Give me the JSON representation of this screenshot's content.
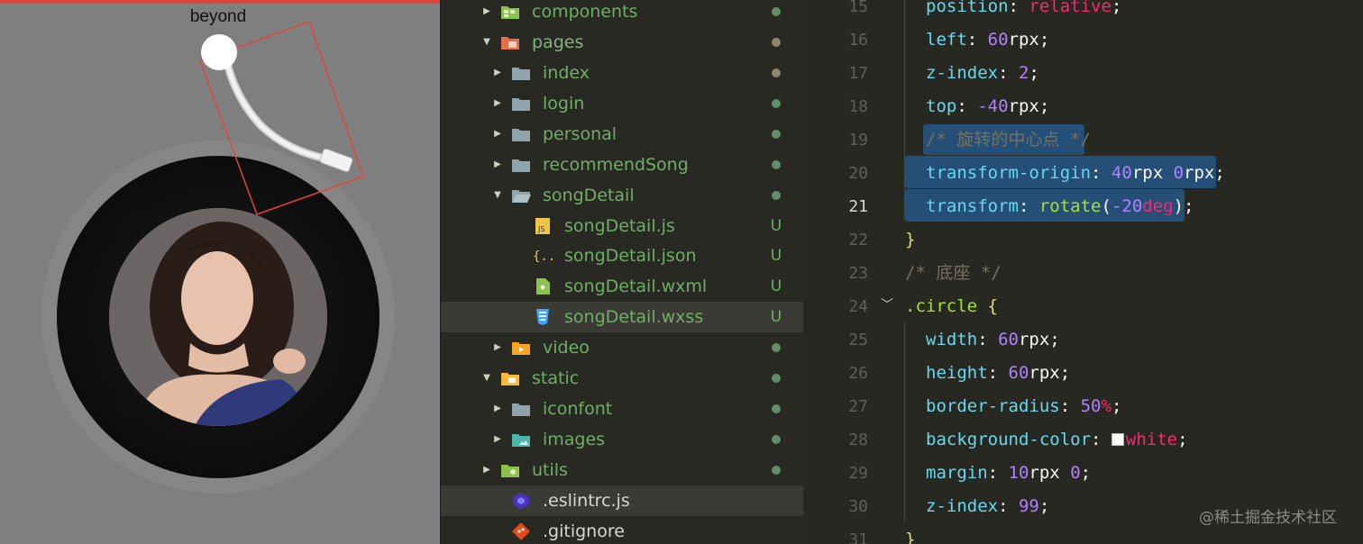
{
  "simulator": {
    "song_title": "beyond",
    "accent_color": "#d9473b"
  },
  "file_tree": {
    "items": [
      {
        "name": "components",
        "icon": "folder-components-icon",
        "status": "dot",
        "status_color": "#5f8f65",
        "expanded": false
      },
      {
        "name": "pages",
        "icon": "folder-pages-open-icon",
        "status": "dot",
        "status_color": "#8d8576",
        "expanded": true
      },
      {
        "name": "index",
        "icon": "folder-icon",
        "status": "dot",
        "status_color": "#8d8576",
        "expanded": false
      },
      {
        "name": "login",
        "icon": "folder-icon",
        "status": "dot",
        "status_color": "#5f8f65",
        "expanded": false
      },
      {
        "name": "personal",
        "icon": "folder-icon",
        "status": "dot",
        "status_color": "#5f8f65",
        "expanded": false
      },
      {
        "name": "recommendSong",
        "icon": "folder-icon",
        "status": "dot",
        "status_color": "#5f8f65",
        "expanded": false
      },
      {
        "name": "songDetail",
        "icon": "folder-open-icon",
        "status": "dot",
        "status_color": "#5f8f65",
        "expanded": true
      },
      {
        "name": "songDetail.js",
        "icon": "js-file-icon",
        "status": "U",
        "status_color": "#6fb06f"
      },
      {
        "name": "songDetail.json",
        "icon": "json-file-icon",
        "status": "U",
        "status_color": "#6fb06f"
      },
      {
        "name": "songDetail.wxml",
        "icon": "wxml-file-icon",
        "status": "U",
        "status_color": "#6fb06f"
      },
      {
        "name": "songDetail.wxss",
        "icon": "css-file-icon",
        "status": "U",
        "status_color": "#6fb06f"
      },
      {
        "name": "video",
        "icon": "folder-video-icon",
        "status": "dot",
        "status_color": "#5f8f65",
        "expanded": false
      },
      {
        "name": "static",
        "icon": "folder-static-open-icon",
        "status": "dot",
        "status_color": "#5f8f65",
        "expanded": true
      },
      {
        "name": "iconfont",
        "icon": "folder-icon",
        "status": "dot",
        "status_color": "#5f8f65",
        "expanded": false
      },
      {
        "name": "images",
        "icon": "folder-images-icon",
        "status": "dot",
        "status_color": "#5f8f65",
        "expanded": false
      },
      {
        "name": "utils",
        "icon": "folder-utils-icon",
        "status": "dot",
        "status_color": "#5f8f65",
        "expanded": false
      },
      {
        "name": ".eslintrc.js",
        "icon": "eslint-icon",
        "status": ""
      },
      {
        "name": ".gitignore",
        "icon": "git-icon",
        "status": ""
      }
    ]
  },
  "editor": {
    "current_line": "21",
    "lines": [
      {
        "n": "15",
        "tokens": [
          [
            "p",
            "position"
          ],
          [
            "w",
            ": "
          ],
          [
            "u",
            "relative"
          ],
          [
            "w",
            ";"
          ]
        ]
      },
      {
        "n": "16",
        "tokens": [
          [
            "p",
            "left"
          ],
          [
            "w",
            ": "
          ],
          [
            "n",
            "60"
          ],
          [
            "w",
            "rpx;"
          ]
        ]
      },
      {
        "n": "17",
        "tokens": [
          [
            "p",
            "z-index"
          ],
          [
            "w",
            ": "
          ],
          [
            "n",
            "2"
          ],
          [
            "w",
            ";"
          ]
        ]
      },
      {
        "n": "18",
        "tokens": [
          [
            "p",
            "top"
          ],
          [
            "w",
            ": "
          ],
          [
            "n",
            "-40"
          ],
          [
            "w",
            "rpx;"
          ]
        ]
      },
      {
        "n": "19",
        "tokens": [
          [
            "c",
            "/* 旋转的中心点 */"
          ]
        ]
      },
      {
        "n": "20",
        "tokens": [
          [
            "p",
            "transform-origin"
          ],
          [
            "w",
            ": "
          ],
          [
            "n",
            "40"
          ],
          [
            "w",
            "rpx "
          ],
          [
            "n",
            "0"
          ],
          [
            "w",
            "rpx;"
          ]
        ]
      },
      {
        "n": "21",
        "tokens": [
          [
            "p",
            "transform"
          ],
          [
            "w",
            ": "
          ],
          [
            "s",
            "rotate"
          ],
          [
            "w",
            "("
          ],
          [
            "n",
            "-20"
          ],
          [
            "u",
            "deg"
          ],
          [
            "w",
            ");"
          ]
        ]
      },
      {
        "n": "22",
        "tokens": [
          [
            "b",
            "}"
          ]
        ]
      },
      {
        "n": "23",
        "tokens": [
          [
            "c",
            "/* 底座 */"
          ]
        ]
      },
      {
        "n": "24",
        "tokens": [
          [
            "s",
            ".circle"
          ],
          [
            "w",
            " "
          ],
          [
            "b",
            "{"
          ]
        ]
      },
      {
        "n": "25",
        "tokens": [
          [
            "p",
            "width"
          ],
          [
            "w",
            ": "
          ],
          [
            "n",
            "60"
          ],
          [
            "w",
            "rpx;"
          ]
        ]
      },
      {
        "n": "26",
        "tokens": [
          [
            "p",
            "height"
          ],
          [
            "w",
            ": "
          ],
          [
            "n",
            "60"
          ],
          [
            "w",
            "rpx;"
          ]
        ]
      },
      {
        "n": "27",
        "tokens": [
          [
            "p",
            "border-radius"
          ],
          [
            "w",
            ": "
          ],
          [
            "n",
            "50"
          ],
          [
            "u",
            "%"
          ],
          [
            "w",
            ";"
          ]
        ]
      },
      {
        "n": "28",
        "tokens": [
          [
            "p",
            "background-color"
          ],
          [
            "w",
            ": "
          ],
          [
            "sw",
            ""
          ],
          [
            "u",
            "white"
          ],
          [
            "w",
            ";"
          ]
        ]
      },
      {
        "n": "29",
        "tokens": [
          [
            "p",
            "margin"
          ],
          [
            "w",
            ": "
          ],
          [
            "n",
            "10"
          ],
          [
            "w",
            "rpx "
          ],
          [
            "n",
            "0"
          ],
          [
            "w",
            ";"
          ]
        ]
      },
      {
        "n": "30",
        "tokens": [
          [
            "p",
            "z-index"
          ],
          [
            "w",
            ": "
          ],
          [
            "n",
            "99"
          ],
          [
            "w",
            ";"
          ]
        ]
      },
      {
        "n": "31",
        "tokens": [
          [
            "b",
            "}"
          ]
        ]
      }
    ]
  },
  "watermark": "@稀土掘金技术社区"
}
